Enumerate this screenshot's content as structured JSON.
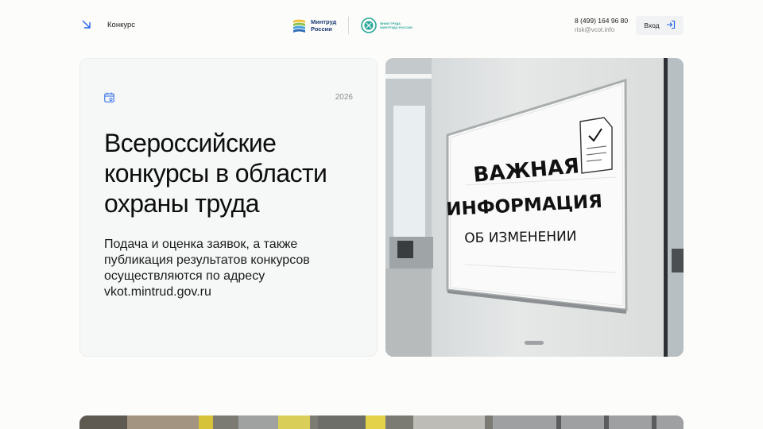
{
  "header": {
    "nav_label": "Конкурс",
    "ministry_logo_line1": "Минтруд",
    "ministry_logo_line2": "России",
    "partner_logo_line1": "ВНИИ ТРУДА",
    "partner_logo_line2": "МИНТРУДА РОССИИ",
    "phone": "8 (499) 164 96 80",
    "email": "risk@vcot.info",
    "login_label": "Вход"
  },
  "hero": {
    "year": "2026",
    "title": "Всероссийские конкурсы в области охраны труда",
    "description": "Подача и оценка заявок, а также публикация результатов конкурсов осуществляются по адресу vkot.mintrud.gov.ru",
    "image_sign_line1": "ВАЖНАЯ",
    "image_sign_line2": "ИНФОРМАЦИЯ",
    "image_sign_line3": "ОБ ИЗМЕНЕНИИ"
  },
  "icons": {
    "nav_arrow": "arrow-down-right-icon",
    "calendar": "calendar-icon",
    "login": "login-icon"
  },
  "colors": {
    "accent": "#2563eb",
    "ministry_blue": "#1d3b74",
    "partner_teal": "#2aa89a",
    "card_bg": "#f6f8f7"
  }
}
